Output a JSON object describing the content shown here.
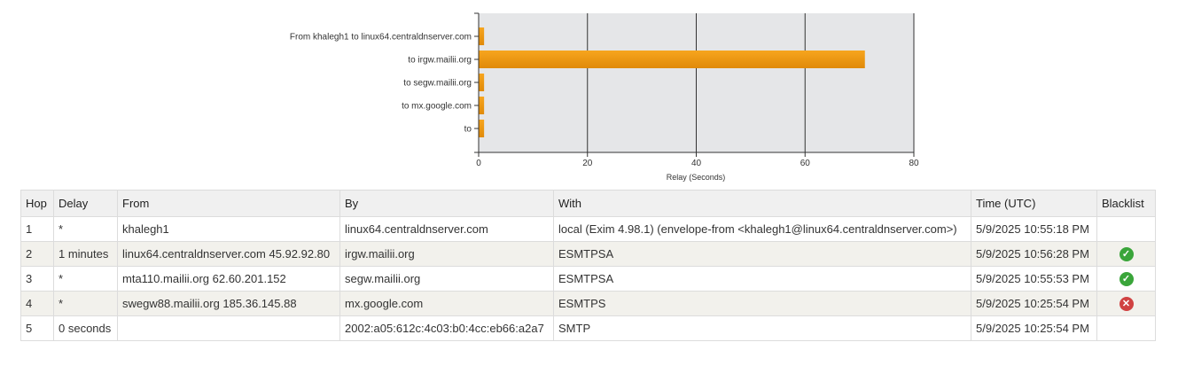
{
  "chart_data": {
    "type": "bar",
    "orientation": "horizontal",
    "categories": [
      "From khalegh1 to linux64.centraldnserver.com",
      "to irgw.mailii.org",
      "to segw.mailii.org",
      "to mx.google.com",
      "to"
    ],
    "values": [
      1,
      71,
      1,
      1,
      1
    ],
    "xlabel": "Relay (Seconds)",
    "ylabel": "",
    "xlim": [
      0,
      80
    ],
    "xticks": [
      0,
      20,
      40,
      60,
      80
    ],
    "grid": true,
    "bar_color": "#f29a0f",
    "plot_background": "#e5e6e8"
  },
  "table": {
    "headers": [
      "Hop",
      "Delay",
      "From",
      "By",
      "With",
      "Time (UTC)",
      "Blacklist"
    ],
    "rows": [
      {
        "hop": "1",
        "delay": "*",
        "from": "khalegh1",
        "by": "linux64.centraldnserver.com",
        "with": "local (Exim 4.98.1) (envelope-from <khalegh1@linux64.centraldnserver.com>)",
        "time": "5/9/2025 10:55:18 PM",
        "blacklist": ""
      },
      {
        "hop": "2",
        "delay": "1 minutes",
        "from": "linux64.centraldnserver.com 45.92.92.80",
        "by": "irgw.mailii.org",
        "with": "ESMTPSA",
        "time": "5/9/2025 10:56:28 PM",
        "blacklist": "ok"
      },
      {
        "hop": "3",
        "delay": "*",
        "from": "mta110.mailii.org 62.60.201.152",
        "by": "segw.mailii.org",
        "with": "ESMTPSA",
        "time": "5/9/2025 10:55:53 PM",
        "blacklist": "ok"
      },
      {
        "hop": "4",
        "delay": "*",
        "from": "swegw88.mailii.org 185.36.145.88",
        "by": "mx.google.com",
        "with": "ESMTPS",
        "time": "5/9/2025 10:25:54 PM",
        "blacklist": "bad"
      },
      {
        "hop": "5",
        "delay": "0 seconds",
        "from": "",
        "by": "2002:a05:612c:4c03:b0:4cc:eb66:a2a7",
        "with": "SMTP",
        "time": "5/9/2025 10:25:54 PM",
        "blacklist": ""
      }
    ]
  },
  "status_colors": {
    "ok": "#3aa53a",
    "bad": "#d04242"
  },
  "status_icons": {
    "ok": "check-circle-icon",
    "bad": "x-circle-icon"
  }
}
